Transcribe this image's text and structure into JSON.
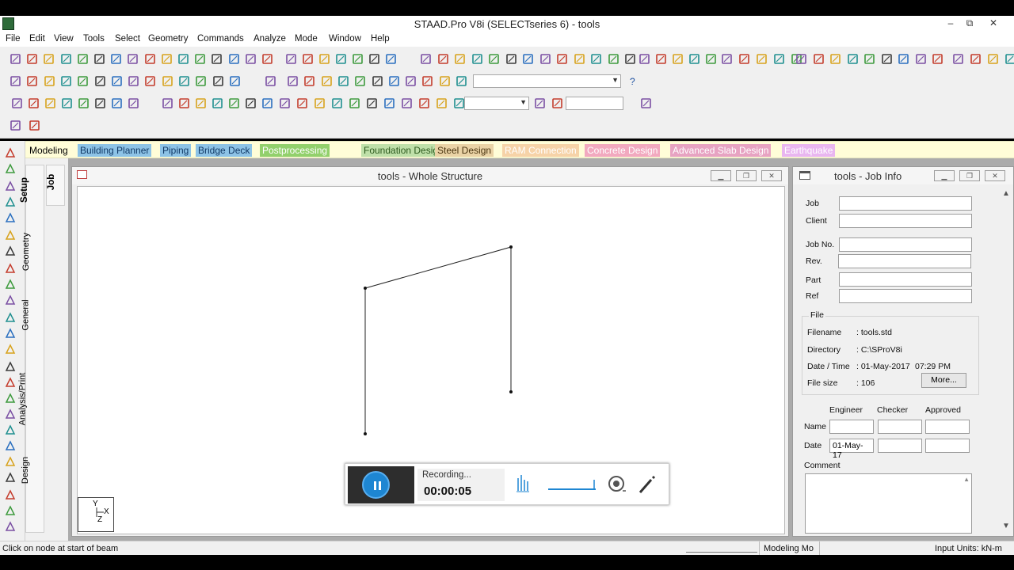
{
  "app": {
    "title": "STAAD.Pro V8i (SELECTseries 6) - tools",
    "window_buttons": {
      "minimize": "–",
      "restore": "⧉",
      "close": "✕"
    }
  },
  "menu": [
    "File",
    "Edit",
    "View",
    "Tools",
    "Select",
    "Geometry",
    "Commands",
    "Analyze",
    "Mode",
    "Window",
    "Help"
  ],
  "page_tabs": [
    {
      "label": "Modeling",
      "bg": "#fffdd8",
      "fg": "#000000"
    },
    {
      "label": "Building Planner",
      "bg": "#8dc3e6",
      "fg": "#123a66"
    },
    {
      "label": "Piping",
      "bg": "#8dc3e6",
      "fg": "#123a66"
    },
    {
      "label": "Bridge Deck",
      "bg": "#8dc3e6",
      "fg": "#123a66"
    },
    {
      "label": "Postprocessing",
      "bg": "#92d06c",
      "fg": "#ffffff"
    },
    {
      "label": "Foundation Design",
      "bg": "#bfe0a9",
      "fg": "#2d5a1e"
    },
    {
      "label": "Steel Design",
      "bg": "#ead3a6",
      "fg": "#4a3510"
    },
    {
      "label": "RAM Connection",
      "bg": "#f6d3a8",
      "fg": "#ffffff"
    },
    {
      "label": "Concrete Design",
      "bg": "#f2a9bf",
      "fg": "#ffffff"
    },
    {
      "label": "Advanced Slab Design",
      "bg": "#e7a3c2",
      "fg": "#ffffff"
    },
    {
      "label": "Earthquake",
      "bg": "#e9b6f0",
      "fg": "#ffffff"
    }
  ],
  "side_tabs": {
    "job": "Job",
    "setup": "Setup",
    "geometry": "Geometry",
    "general": "General",
    "analysis": "Analysis/Print",
    "design": "Design"
  },
  "structure_window": {
    "title": "tools - Whole Structure",
    "axis": {
      "y": "Y",
      "x": "X",
      "z": "Z"
    }
  },
  "job_info": {
    "title": "tools - Job Info",
    "fields": {
      "job": "Job",
      "client": "Client",
      "job_no": "Job No.",
      "rev": "Rev.",
      "part": "Part",
      "ref": "Ref"
    },
    "file_group": "File",
    "filename_label": "Filename",
    "filename_value": ": tools.std",
    "directory_label": "Directory",
    "directory_value": ": C:\\SProV8i",
    "datetime_label": "Date / Time",
    "datetime_value": ": 01-May-2017",
    "time_value": "07:29 PM",
    "filesize_label": "File size",
    "filesize_value": ": 106",
    "more_button": "More...",
    "col_engineer": "Engineer",
    "col_checker": "Checker",
    "col_approved": "Approved",
    "name_label": "Name",
    "date_label": "Date",
    "engineer_date": "01-May-17",
    "comment_label": "Comment"
  },
  "recorder": {
    "status": "Recording...",
    "time": "00:00:05"
  },
  "status_bar": {
    "message": "Click on node at start of beam",
    "mode": "Modeling Mo",
    "units": "Input Units:  kN-m"
  }
}
